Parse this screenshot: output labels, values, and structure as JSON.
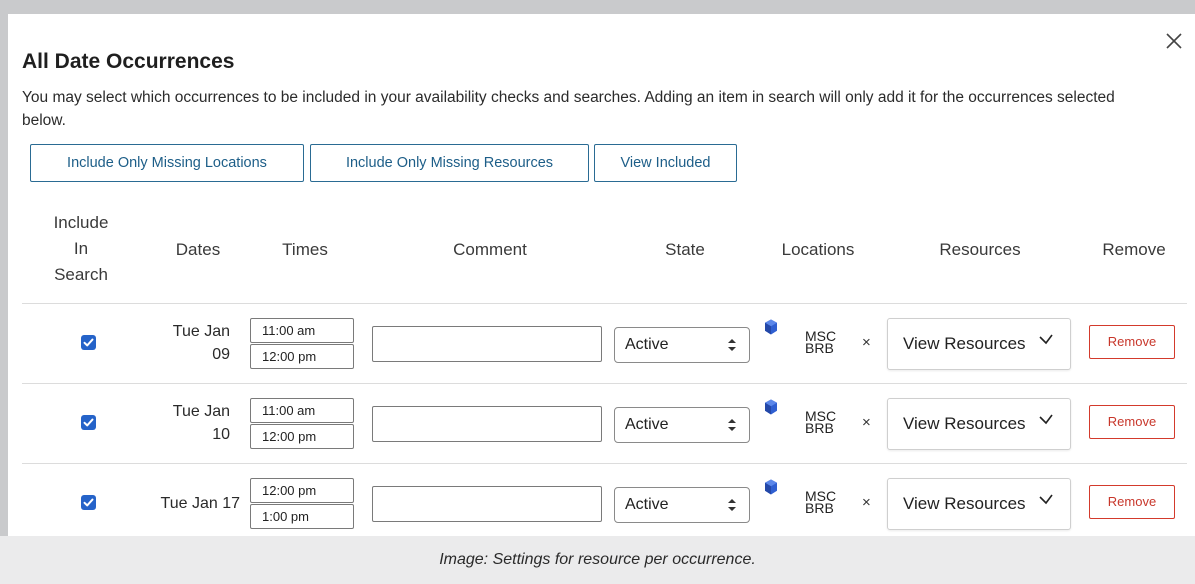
{
  "dialog": {
    "title": "All Date Occurrences",
    "description": "You may select which occurrences to be included in your availability checks and searches. Adding an item in search will only add it for the occurrences selected below.",
    "close_icon": "close-icon"
  },
  "toolbar": {
    "missing_locations": "Include Only Missing Locations",
    "missing_resources": "Include Only Missing Resources",
    "view_included": "View Included"
  },
  "table": {
    "headers": {
      "include": "Include In Search",
      "include_lines": [
        "Include",
        "In",
        "Search"
      ],
      "dates": "Dates",
      "times": "Times",
      "comment": "Comment",
      "state": "State",
      "locations": "Locations",
      "resources": "Resources",
      "remove": "Remove"
    },
    "rows": [
      {
        "checked": true,
        "date_line1": "Tue Jan",
        "date_line2": "09",
        "start_time": "11:00 am",
        "end_time": "12:00 pm",
        "comment": "",
        "state": "Active",
        "location_icon": "cube-icon",
        "location_line1": "MSC",
        "location_line2": "BRB",
        "remove_location": "×",
        "resources_label": "View Resources",
        "remove_label": "Remove"
      },
      {
        "checked": true,
        "date_line1": "Tue Jan",
        "date_line2": "10",
        "start_time": "11:00 am",
        "end_time": "12:00 pm",
        "comment": "",
        "state": "Active",
        "location_icon": "cube-icon",
        "location_line1": "MSC",
        "location_line2": "BRB",
        "remove_location": "×",
        "resources_label": "View Resources",
        "remove_label": "Remove"
      },
      {
        "checked": true,
        "date_line1": "Tue Jan 17",
        "date_line2": "",
        "start_time": "12:00 pm",
        "end_time": "1:00 pm",
        "comment": "",
        "state": "Active",
        "location_icon": "cube-icon",
        "location_line1": "MSC",
        "location_line2": "BRB",
        "remove_location": "×",
        "resources_label": "View Resources",
        "remove_label": "Remove"
      }
    ]
  },
  "caption": "Image: Settings for resource per occurrence.",
  "colors": {
    "accent": "#1d5e88",
    "checkbox": "#2563c9",
    "danger": "#c8372b",
    "cube": "#2f5fd1"
  }
}
